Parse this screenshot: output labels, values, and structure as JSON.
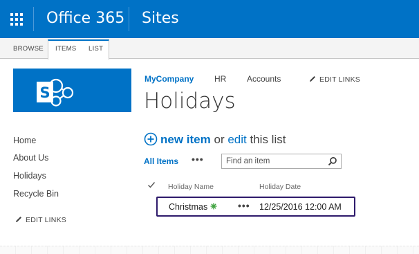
{
  "suitebar": {
    "app_title": "Office 365",
    "section_title": "Sites",
    "accent_color": "#0072c6"
  },
  "ribbon": {
    "tabs": [
      {
        "label": "BROWSE"
      },
      {
        "label": "ITEMS"
      },
      {
        "label": "LIST"
      }
    ]
  },
  "topnav": {
    "items": [
      {
        "label": "MyCompany",
        "active": true
      },
      {
        "label": "HR",
        "active": false
      },
      {
        "label": "Accounts",
        "active": false
      }
    ],
    "edit_links": "EDIT LINKS"
  },
  "page": {
    "title": "Holidays"
  },
  "quicklaunch": {
    "items": [
      {
        "label": "Home"
      },
      {
        "label": "About Us"
      },
      {
        "label": "Holidays"
      },
      {
        "label": "Recycle Bin"
      }
    ],
    "edit_links": "EDIT LINKS"
  },
  "list": {
    "new_item_label": "new item",
    "or_text": "or",
    "edit_label": "edit",
    "this_list_text": "this list",
    "view_label": "All Items",
    "view_more": "•••",
    "search_placeholder": "Find an item",
    "columns": [
      "Holiday Name",
      "Holiday Date"
    ],
    "rows": [
      {
        "name": "Christmas",
        "date": "12/25/2016 12:00 AM",
        "is_new": true,
        "more": "•••"
      }
    ]
  }
}
